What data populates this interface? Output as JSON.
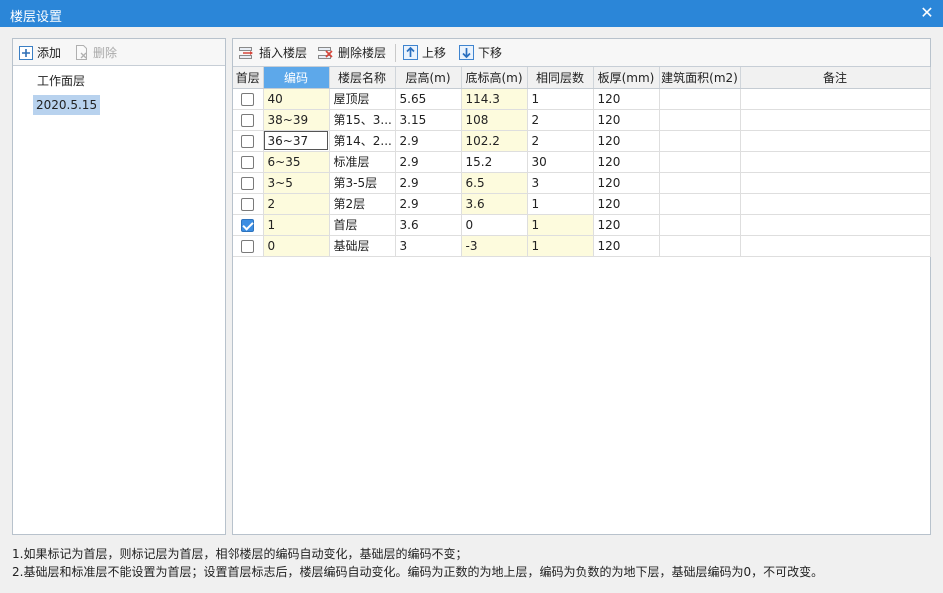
{
  "window": {
    "title": "楼层设置",
    "close_glyph": "✕"
  },
  "left_toolbar": {
    "add_label": "添加",
    "delete_label": "删除"
  },
  "tree": {
    "items": [
      "工作面层",
      "2020.5.15"
    ],
    "selected_index": 1
  },
  "right_toolbar": {
    "insert_label": "插入楼层",
    "delete_label": "删除楼层",
    "up_label": "上移",
    "down_label": "下移"
  },
  "table": {
    "columns": [
      "首层",
      "编码",
      "楼层名称",
      "层高(m)",
      "底标高(m)",
      "相同层数",
      "板厚(mm)",
      "建筑面积(m2)",
      "备注"
    ],
    "active_column": 1,
    "rows": [
      {
        "first": false,
        "code": "40",
        "name": "屋顶层",
        "height": "5.65",
        "bottom": "114.3",
        "same": "1",
        "slab": "120",
        "area": "",
        "note": ""
      },
      {
        "first": false,
        "code": "38~39",
        "name": "第15、3...",
        "height": "3.15",
        "bottom": "108",
        "same": "2",
        "slab": "120",
        "area": "",
        "note": ""
      },
      {
        "first": false,
        "code": "36~37",
        "name": "第14、2...",
        "height": "2.9",
        "bottom": "102.2",
        "same": "2",
        "slab": "120",
        "area": "",
        "note": ""
      },
      {
        "first": false,
        "code": "6~35",
        "name": "标准层",
        "height": "2.9",
        "bottom": "15.2",
        "same": "30",
        "slab": "120",
        "area": "",
        "note": ""
      },
      {
        "first": false,
        "code": "3~5",
        "name": "第3-5层",
        "height": "2.9",
        "bottom": "6.5",
        "same": "3",
        "slab": "120",
        "area": "",
        "note": ""
      },
      {
        "first": false,
        "code": "2",
        "name": "第2层",
        "height": "2.9",
        "bottom": "3.6",
        "same": "1",
        "slab": "120",
        "area": "",
        "note": ""
      },
      {
        "first": true,
        "code": "1",
        "name": "首层",
        "height": "3.6",
        "bottom": "0",
        "same": "1",
        "slab": "120",
        "area": "",
        "note": ""
      },
      {
        "first": false,
        "code": "0",
        "name": "基础层",
        "height": "3",
        "bottom": "-3",
        "same": "1",
        "slab": "120",
        "area": "",
        "note": ""
      }
    ]
  },
  "notes": [
    "1.如果标记为首层，则标记层为首层，相邻楼层的编码自动变化，基础层的编码不变；",
    "2.基础层和标准层不能设置为首层；设置首层标志后，楼层编码自动变化。编码为正数的为地上层，编码为负数的为地下层，基础层编码为0，不可改变。"
  ]
}
